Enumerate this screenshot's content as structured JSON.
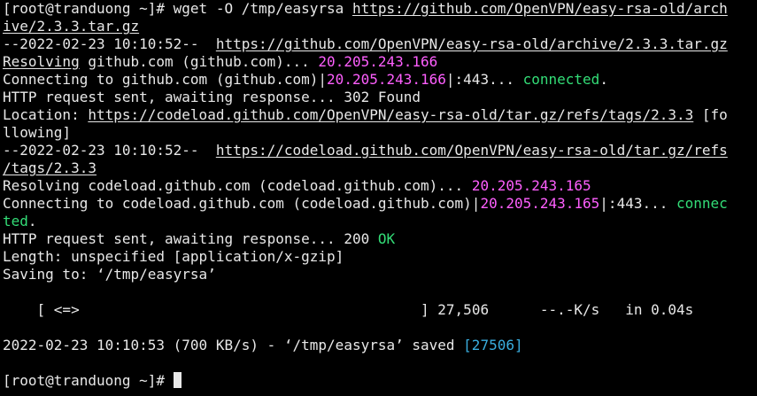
{
  "terminal": {
    "prompt": "[root@tranduong ~]# ",
    "command_prefix": "wget -O /tmp/easyrsa ",
    "url_part1": "https://github.com/OpenVPN/easy-rsa-old/arch",
    "url_part2": "ive/2.3.3.tar.gz",
    "l3_time": "--2022-02-23 10:10:52--  ",
    "l3_url": "https://github.com/OpenVPN/easy-rsa-old/archive/2.3.3.tar.gz",
    "l4_resolving": "Resolving",
    "l4_text": " github.com (github.com)... ",
    "l4_ip": "20.205.243.166",
    "l5_text": "Connecting to github.com (github.com)|",
    "l5_ip": "20.205.243.166",
    "l5_port": "|:443... ",
    "l5_status": "connected",
    "l5_end": ".",
    "l6": "HTTP request sent, awaiting response... 302 Found",
    "l7_label": "Location: ",
    "l7_url": "https://codeload.github.com/OpenVPN/easy-rsa-old/tar.gz/refs/tags/2.3.3",
    "l7_tail": " [fo",
    "l8": "llowing]",
    "l9_time": "--2022-02-23 10:10:52--  ",
    "l9_url": "https://codeload.github.com/OpenVPN/easy-rsa-old/tar.gz/refs",
    "l10_url": "/tags/2.3.3",
    "l11_text": "Resolving codeload.github.com (codeload.github.com)... ",
    "l11_ip": "20.205.243.165",
    "l12_text": "Connecting to codeload.github.com (codeload.github.com)|",
    "l12_ip": "20.205.243.165",
    "l12_port": "|:443... ",
    "l12_status": "connec",
    "l13_status": "ted",
    "l13_end": ".",
    "l14_text": "HTTP request sent, awaiting response... 200 ",
    "l14_ok": "OK",
    "l15": "Length: unspecified [application/x-gzip]",
    "l16": "Saving to: ‘/tmp/easyrsa’",
    "progress_left": "    [ <=>",
    "progress_right": "] 27,506      --.-K/s   in 0.04s",
    "l20_text": "2022-02-23 10:10:53 (700 KB/s) - ‘/tmp/easyrsa’ saved ",
    "l20_bytes": "[27506]",
    "final_prompt": "[root@tranduong ~]# "
  },
  "colors": {
    "background": "#000000",
    "text": "#e8e8e8",
    "ip_magenta": "#ff5fff",
    "status_green": "#33dd77",
    "bytes_cyan": "#3aaedf"
  }
}
